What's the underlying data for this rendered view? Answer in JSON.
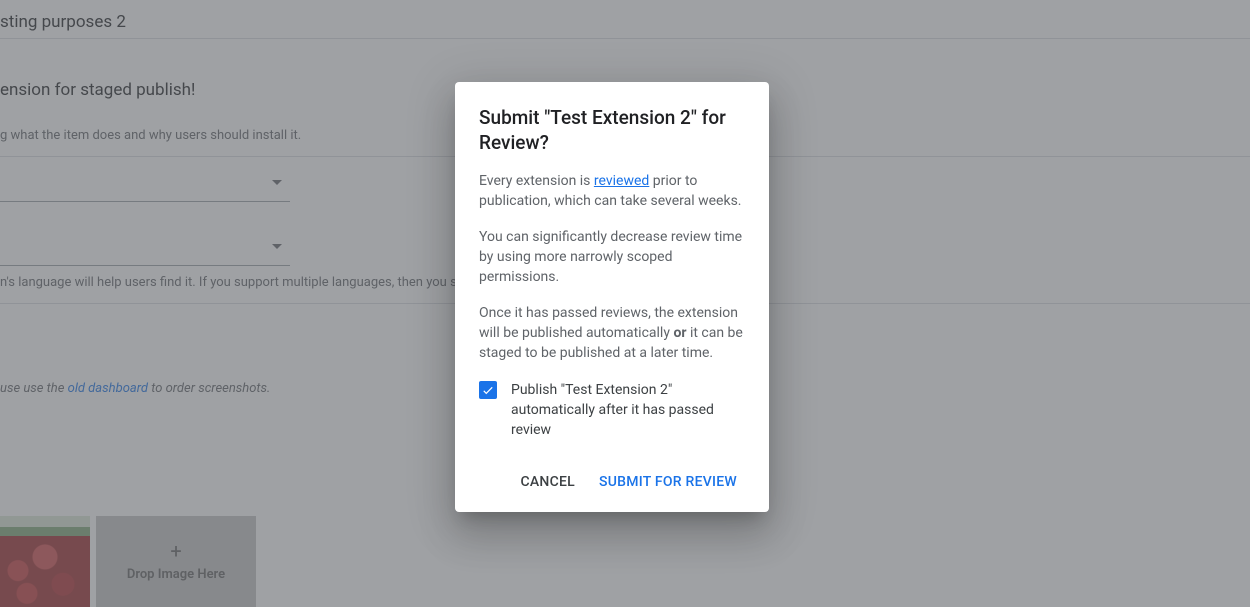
{
  "background": {
    "title_fragment": "sting purposes 2",
    "section_heading": "ension for staged publish!",
    "helper1": "g what the item does and why users should install it.",
    "lang_note_prefix": "n's language will help users find it. If you support multiple languages, then you sh",
    "screenshots_note_prefix": "use use the ",
    "screenshots_link": "old dashboard",
    "screenshots_note_suffix": " to order screenshots.",
    "drop_label": "Drop Image Here"
  },
  "dialog": {
    "title": "Submit \"Test Extension 2\" for Review?",
    "p1_prefix": "Every extension is ",
    "p1_link": "reviewed",
    "p1_suffix": " prior to publication, which can take several weeks.",
    "p2": "You can significantly decrease review time by using more narrowly scoped permissions.",
    "p3_prefix": "Once it has passed reviews, the extension will be published automatically ",
    "p3_bold": "or",
    "p3_suffix": " it can be staged to be published at a later time.",
    "checkbox_label": "Publish \"Test Extension 2\" automatically after it has passed review",
    "cancel": "Cancel",
    "submit": "Submit for Review"
  }
}
